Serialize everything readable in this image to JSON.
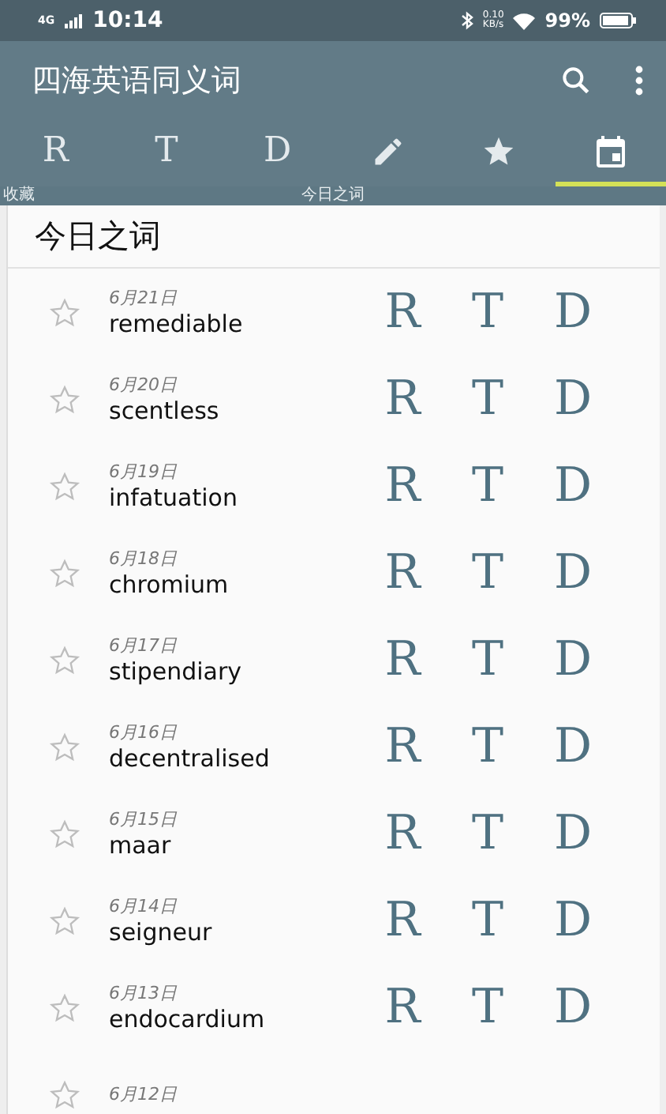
{
  "status_bar": {
    "network": "4G",
    "time": "10:14",
    "speed_value": "0.10",
    "speed_unit": "KB/s",
    "battery": "99%"
  },
  "app_bar": {
    "title": "四海英语同义词"
  },
  "tabs": [
    {
      "kind": "letter",
      "label": "R",
      "selected": false
    },
    {
      "kind": "letter",
      "label": "T",
      "selected": false
    },
    {
      "kind": "letter",
      "label": "D",
      "selected": false
    },
    {
      "kind": "pencil",
      "selected": false
    },
    {
      "kind": "star",
      "selected": false
    },
    {
      "kind": "calendar",
      "selected": true
    }
  ],
  "tab_titles": [
    "收藏",
    "今日之词"
  ],
  "card": {
    "title": "今日之词",
    "words": [
      {
        "date": "6月21日",
        "word": "remediable",
        "starred": false,
        "links": [
          "R",
          "T",
          "D"
        ]
      },
      {
        "date": "6月20日",
        "word": "scentless",
        "starred": false,
        "links": [
          "R",
          "T",
          "D"
        ]
      },
      {
        "date": "6月19日",
        "word": "infatuation",
        "starred": false,
        "links": [
          "R",
          "T",
          "D"
        ]
      },
      {
        "date": "6月18日",
        "word": "chromium",
        "starred": false,
        "links": [
          "R",
          "T",
          "D"
        ]
      },
      {
        "date": "6月17日",
        "word": "stipendiary",
        "starred": false,
        "links": [
          "R",
          "T",
          "D"
        ]
      },
      {
        "date": "6月16日",
        "word": "decentralised",
        "starred": false,
        "links": [
          "R",
          "T",
          "D"
        ]
      },
      {
        "date": "6月15日",
        "word": "maar",
        "starred": false,
        "links": [
          "R",
          "T",
          "D"
        ]
      },
      {
        "date": "6月14日",
        "word": "seigneur",
        "starred": false,
        "links": [
          "R",
          "T",
          "D"
        ]
      },
      {
        "date": "6月13日",
        "word": "endocardium",
        "starred": false,
        "links": [
          "R",
          "T",
          "D"
        ]
      },
      {
        "date": "6月12日",
        "starred": false
      }
    ]
  }
}
